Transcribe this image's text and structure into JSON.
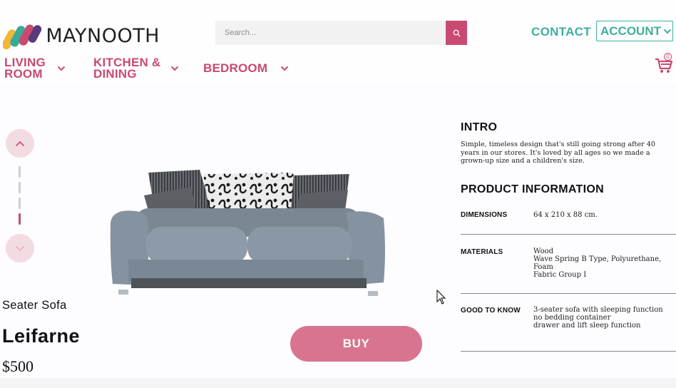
{
  "brand": {
    "name": "MAYNOOTH"
  },
  "search": {
    "placeholder": "Search..."
  },
  "header": {
    "contact_label": "CONTACT",
    "account_label": "ACCOUNT"
  },
  "nav": {
    "items": [
      {
        "line1": "LIVING",
        "line2": "ROOM"
      },
      {
        "line1": "KITCHEN &",
        "line2": "DINING"
      },
      {
        "line1": "BEDROOM",
        "line2": ""
      }
    ]
  },
  "cart": {
    "count": "0"
  },
  "gallery": {
    "total": 4,
    "active_index": 4
  },
  "product": {
    "subtitle": "Seater Sofa",
    "name": "Leifarne",
    "price": "$500",
    "buy_label": "BUY"
  },
  "intro": {
    "heading": "INTRO",
    "text": "Simple, timeless design that's still going strong after 40 years in our stores. It's loved by all ages so we made a grown-up size and a children's size."
  },
  "product_info": {
    "heading": "PRODUCT INFORMATION",
    "specs": [
      {
        "key": "DIMENSIONS",
        "lines": [
          "64 x 210 x 88 cm."
        ]
      },
      {
        "key": "MATERIALS",
        "lines": [
          "Wood",
          "Wave Spring B Type, Polyurethane,",
          "Foam",
          "Fabric Group I"
        ]
      },
      {
        "key": "GOOD TO KNOW",
        "lines": [
          "3-seater sofa with sleeping function",
          "no bedding container",
          "drawer and lift sleep function"
        ]
      }
    ]
  },
  "colors": {
    "accent_pink": "#c94a70",
    "accent_teal": "#3fae9f",
    "button_pink": "#d87490"
  }
}
